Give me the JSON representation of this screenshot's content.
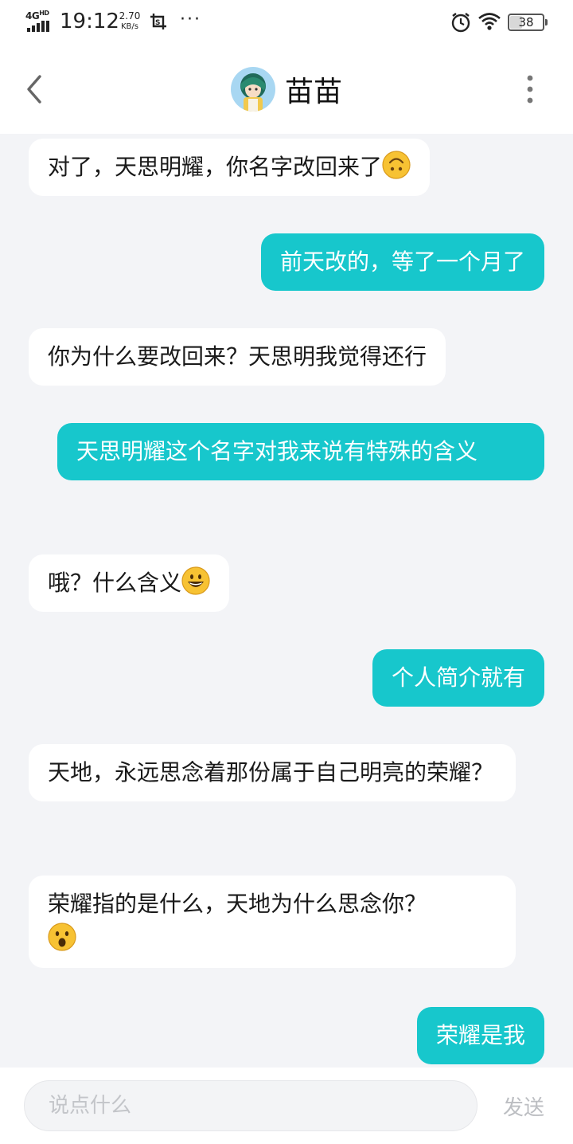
{
  "status_bar": {
    "network": "4G",
    "network_sup": "HD",
    "time": "19:12",
    "speed_value": "2.70",
    "speed_unit": "KB/s",
    "overflow": "···",
    "battery": "38"
  },
  "header": {
    "title": "苗苗",
    "back_icon": "chevron-left-icon",
    "more_icon": "more-vertical-icon"
  },
  "messages": [
    {
      "side": "in",
      "text": "对了，天思明耀，你名字改回来了",
      "emoji": "upside-down-face"
    },
    {
      "side": "out",
      "text": "前天改的，等了一个月了"
    },
    {
      "side": "in",
      "text": "你为什么要改回来？天思明我觉得还行"
    },
    {
      "side": "out",
      "text": "天思明耀这个名字对我来说有特殊的含义"
    },
    {
      "side": "in",
      "text": "哦？什么含义",
      "emoji": "grinning-face"
    },
    {
      "side": "out",
      "text": "个人简介就有"
    },
    {
      "side": "in",
      "text": "天地，永远思念着那份属于自己明亮的荣耀？"
    },
    {
      "side": "in",
      "text": "荣耀指的是什么，天地为什么思念你？",
      "emoji": "surprised-face"
    },
    {
      "side": "out",
      "text": "荣耀是我"
    }
  ],
  "input_bar": {
    "placeholder": "说点什么",
    "send_label": "发送"
  },
  "colors": {
    "outgoing_bubble": "#17c7cc",
    "incoming_bubble": "#ffffff",
    "chat_background": "#f3f4f7"
  }
}
